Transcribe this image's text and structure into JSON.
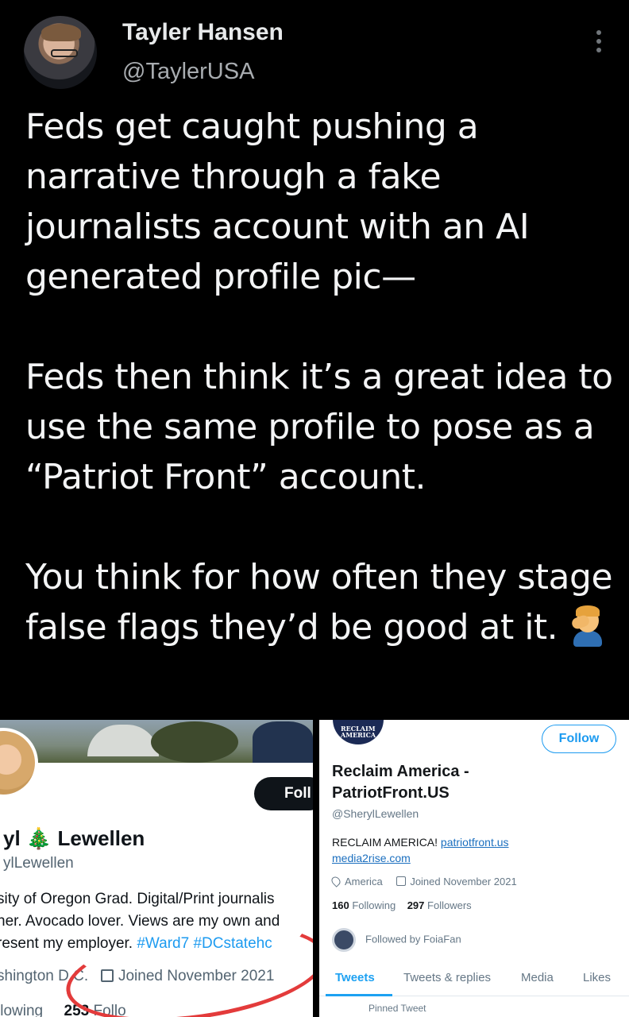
{
  "author": {
    "name": "Tayler Hansen",
    "handle": "@TaylerUSA"
  },
  "tweet": {
    "paragraphs": [
      "Feds get caught pushing a narrative through a fake journalists account with an AI generated profile pic—",
      "Feds then think it’s a great idea to use the same profile to pose as a “Patriot Front” account.",
      "You think for how often they stage false flags they’d be good at it."
    ],
    "emoji": "facepalm-emoji"
  },
  "left_profile": {
    "follow_label": "Foll",
    "name": "yl 🎄 Lewellen",
    "handle": "ylLewellen",
    "bio_lines": [
      "sity of Oregon Grad. Digital/Print journalis",
      "ner. Avocado lover. Views are my own and",
      "resent my employer. "
    ],
    "bio_tags": "#Ward7 #DCstatehc",
    "location": "shington D.C.",
    "joined": "Joined November 2021",
    "following_count": "253",
    "following_label": "llowing",
    "followers_label": "Follo",
    "annotation_color": "#e33b3b"
  },
  "right_profile": {
    "avatar_text": "RECLAIM AMERICA",
    "follow_label": "Follow",
    "name": "Reclaim America - PatriotFront.US",
    "handle": "@SherylLewellen",
    "bio_text": "RECLAIM AMERICA! ",
    "bio_link1": "patriotfront.us",
    "bio_link2": "media2rise.com",
    "location": "America",
    "joined": "Joined November 2021",
    "following_count": "160",
    "following_label": "Following",
    "followers_count": "297",
    "followers_label": "Followers",
    "followed_by": "Followed by FoiaFan",
    "tabs": [
      "Tweets",
      "Tweets & replies",
      "Media",
      "Likes"
    ],
    "pinned": "Pinned Tweet",
    "accent_color": "#1da1f2"
  }
}
